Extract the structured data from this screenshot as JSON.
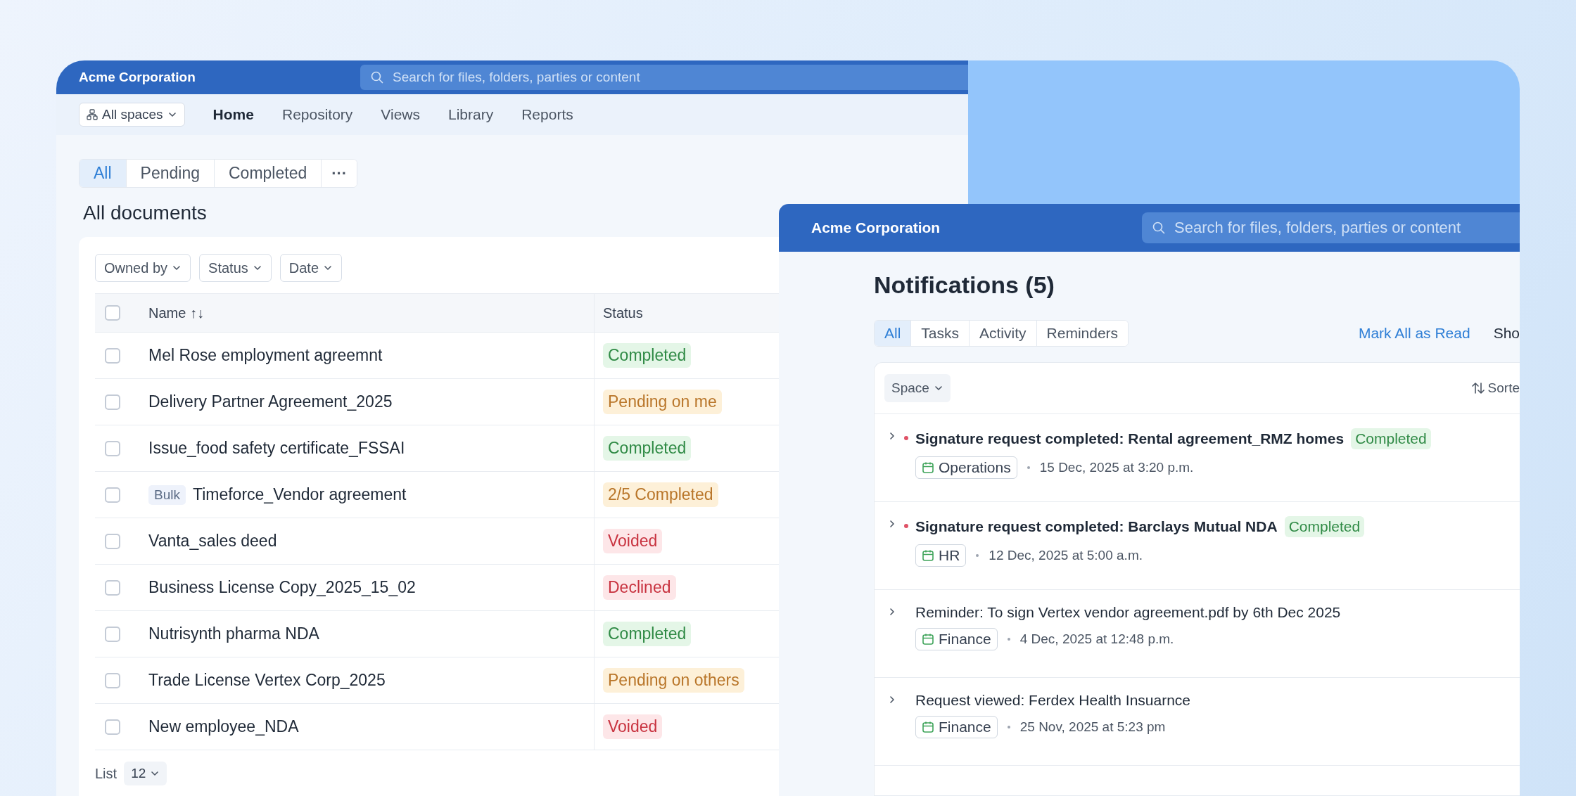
{
  "documents_window": {
    "brand": "Acme Corporation",
    "search": {
      "placeholder": "Search for files, folders, parties or content"
    },
    "space_selector": "All spaces",
    "nav": [
      {
        "label": "Home",
        "selected": true
      },
      {
        "label": "Repository",
        "selected": false
      },
      {
        "label": "Views",
        "selected": false
      },
      {
        "label": "Library",
        "selected": false
      },
      {
        "label": "Reports",
        "selected": false
      }
    ],
    "tabs": [
      {
        "label": "All",
        "selected": true
      },
      {
        "label": "Pending",
        "selected": false
      },
      {
        "label": "Completed",
        "selected": false
      }
    ],
    "more_button": "···",
    "heading": "All documents",
    "filters": [
      "Owned by",
      "Status",
      "Date"
    ],
    "table": {
      "header_checked": false,
      "columns": [
        "Name ↑↓",
        "Status"
      ],
      "rows": [
        {
          "checked": false,
          "name": "Mel Rose employment agreemnt",
          "status": "Completed",
          "kind": "success"
        },
        {
          "checked": false,
          "name": "Delivery Partner Agreement_2025",
          "status": "Pending on me",
          "kind": "warning"
        },
        {
          "checked": false,
          "name": "Issue_food safety certificate_FSSAI",
          "status": "Completed",
          "kind": "success"
        },
        {
          "checked": false,
          "tag": "Bulk",
          "name": "Timeforce_Vendor agreement",
          "status": "2/5 Completed",
          "kind": "warning"
        },
        {
          "checked": false,
          "name": "Vanta_sales deed",
          "status": "Voided",
          "kind": "danger"
        },
        {
          "checked": false,
          "name": "Business License Copy_2025_15_02",
          "status": "Declined",
          "kind": "danger"
        },
        {
          "checked": false,
          "name": "Nutrisynth pharma NDA",
          "status": "Completed",
          "kind": "success"
        },
        {
          "checked": false,
          "name": "Trade License Vertex Corp_2025",
          "status": "Pending on others",
          "kind": "warning"
        },
        {
          "checked": false,
          "name": "New employee_NDA",
          "status": "Voided",
          "kind": "danger"
        }
      ]
    },
    "pagination": {
      "label": "List",
      "page_size": "12"
    }
  },
  "notifications_window": {
    "brand": "Acme Corporation",
    "search": {
      "placeholder": "Search for files, folders, parties or content"
    },
    "title": "Notifications (5)",
    "tabs": [
      {
        "label": "All",
        "selected": true
      },
      {
        "label": "Tasks",
        "selected": false
      },
      {
        "label": "Activity",
        "selected": false
      },
      {
        "label": "Reminders",
        "selected": false
      }
    ],
    "mark_all_read": "Mark All as Read",
    "cut_action": "Sho",
    "space_filter": "Space",
    "sort": "Sorte",
    "items": [
      {
        "unread": true,
        "title": "Signature request completed: Rental agreement_RMZ homes",
        "status": "Completed",
        "space": "Operations",
        "time": "15 Dec, 2025 at 3:20 p.m."
      },
      {
        "unread": true,
        "title": "Signature request completed: Barclays Mutual NDA",
        "status": "Completed",
        "space": "HR",
        "time": "12 Dec, 2025 at 5:00 a.m."
      },
      {
        "unread": false,
        "title": "Reminder: To sign Vertex vendor agreement.pdf by 6th Dec 2025",
        "space": "Finance",
        "time": "4 Dec, 2025 at 12:48 p.m."
      },
      {
        "unread": false,
        "title": "Request viewed: Ferdex Health Insuarnce",
        "space": "Finance",
        "time": "25 Nov, 2025 at 5:23 pm"
      }
    ]
  }
}
